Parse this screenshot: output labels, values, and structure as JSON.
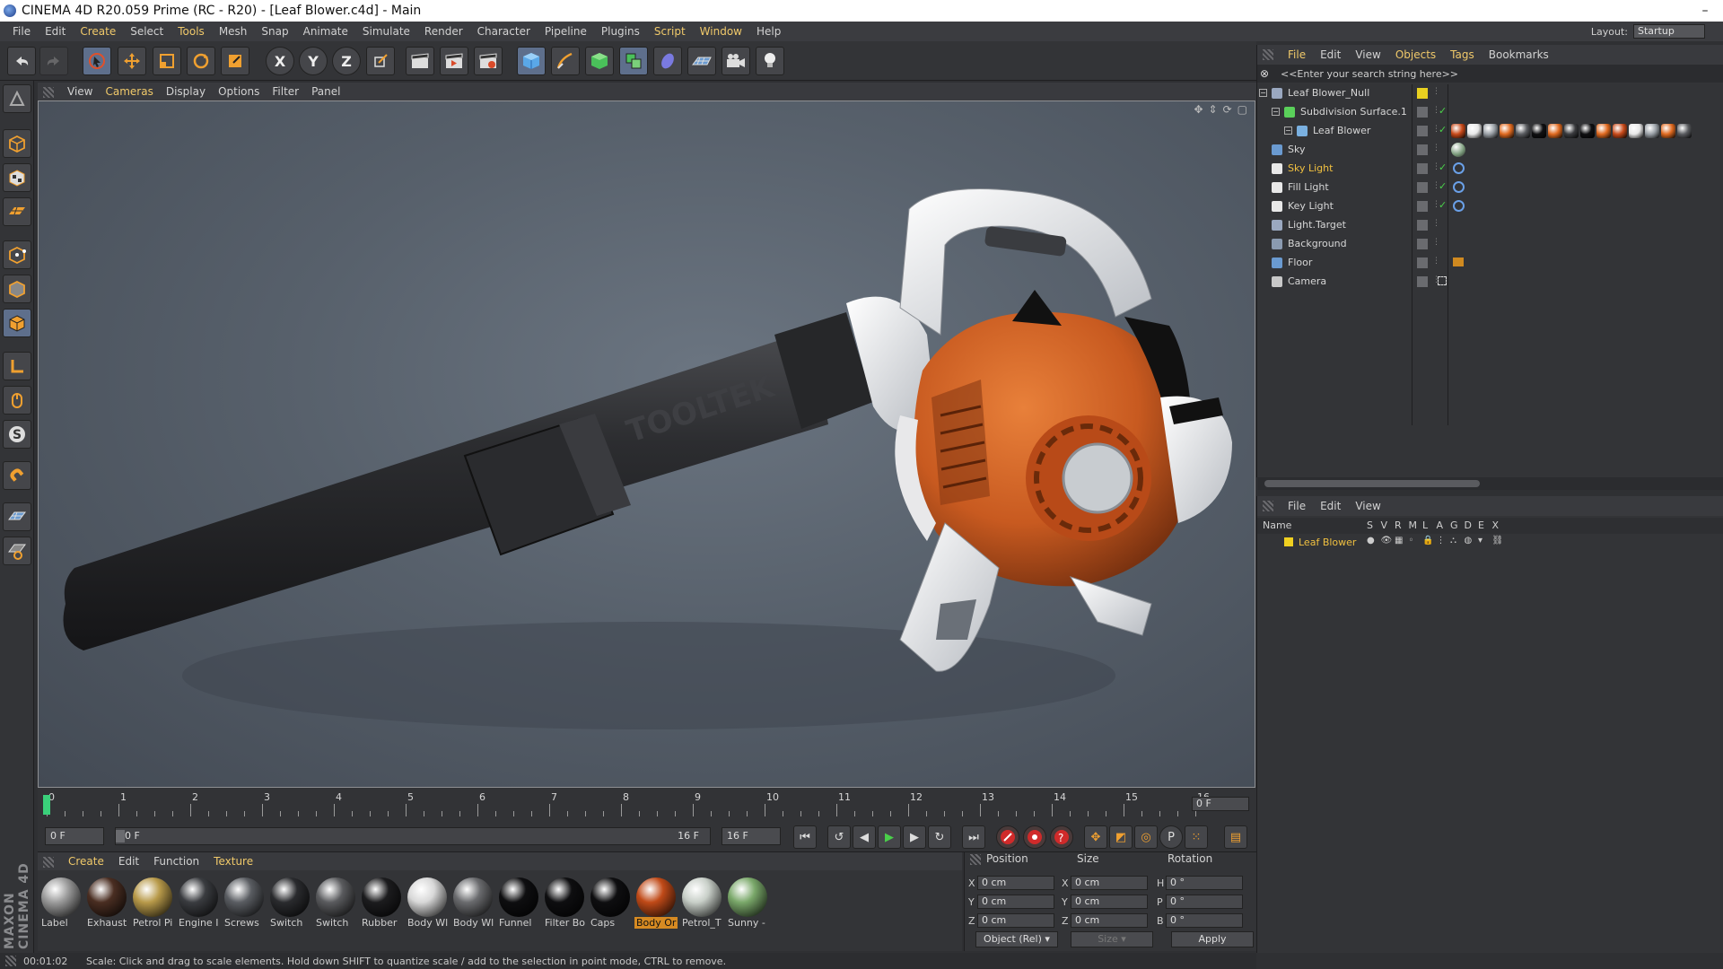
{
  "window": {
    "title": "CINEMA 4D R20.059 Prime (RC - R20) - [Leaf Blower.c4d] - Main",
    "minimize": "–"
  },
  "menubar": [
    "File",
    "Edit",
    "Create",
    "Select",
    "Tools",
    "Mesh",
    "Snap",
    "Animate",
    "Simulate",
    "Render",
    "Character",
    "Pipeline",
    "Plugins",
    "Script",
    "Window",
    "Help"
  ],
  "menubar_highlight": [
    "Create",
    "Tools",
    "Script",
    "Window"
  ],
  "layout": {
    "label": "Layout:",
    "value": "Startup"
  },
  "toolbar": {
    "x": "X",
    "y": "Y",
    "z": "Z"
  },
  "viewport_menu": [
    "View",
    "Cameras",
    "Display",
    "Options",
    "Filter",
    "Panel"
  ],
  "viewport_menu_highlight": [
    "Cameras"
  ],
  "model": {
    "brand": "TOOLTEK"
  },
  "timeline": {
    "ticks": [
      "0",
      "1",
      "2",
      "3",
      "4",
      "5",
      "6",
      "7",
      "8",
      "9",
      "10",
      "11",
      "12",
      "13",
      "14",
      "15",
      "16"
    ],
    "frame": "0 F"
  },
  "playbar": {
    "start": "0 F",
    "range_start": "0 F",
    "range_end": "16 F",
    "end": "16 F",
    "playhead_fraction": 0
  },
  "materials": {
    "menu": [
      "Create",
      "Edit",
      "Function",
      "Texture"
    ],
    "menu_highlight": [
      "Create",
      "Texture"
    ],
    "items": [
      {
        "label": "Label",
        "color": "#9c9c9c"
      },
      {
        "label": "Exhaust",
        "color": "#4a2e22"
      },
      {
        "label": "Petrol Pi",
        "color": "#b89a4a"
      },
      {
        "label": "Engine I",
        "color": "#3a3c40"
      },
      {
        "label": "Screws",
        "color": "#5a5d62"
      },
      {
        "label": "Switch",
        "color": "#2a2b2e"
      },
      {
        "label": "Switch",
        "color": "#5a5b5e"
      },
      {
        "label": "Rubber",
        "color": "#1c1c1e"
      },
      {
        "label": "Body Wl",
        "color": "#d8d8d8"
      },
      {
        "label": "Body Wl",
        "color": "#6a6b6e"
      },
      {
        "label": "Funnel",
        "color": "#0e0e10"
      },
      {
        "label": "Filter Bo",
        "color": "#0e0e10"
      },
      {
        "label": "Caps",
        "color": "#0e0e10"
      },
      {
        "label": "Body Or",
        "color": "#c04a18"
      },
      {
        "label": "Petrol_T",
        "color": "#c8cfc8"
      },
      {
        "label": "Sunny -",
        "color": "#7aa86a"
      }
    ],
    "selected_index": 13
  },
  "attributes": {
    "headers": {
      "position": "Position",
      "size": "Size",
      "rotation": "Rotation"
    },
    "rows": [
      {
        "axis": "X",
        "pos": "0 cm",
        "size_axis": "X",
        "size": "0 cm",
        "rot_axis": "H",
        "rot": "0 °"
      },
      {
        "axis": "Y",
        "pos": "0 cm",
        "size_axis": "Y",
        "size": "0 cm",
        "rot_axis": "P",
        "rot": "0 °"
      },
      {
        "axis": "Z",
        "pos": "0 cm",
        "size_axis": "Z",
        "size": "0 cm",
        "rot_axis": "B",
        "rot": "0 °"
      }
    ],
    "mode": "Object (Rel)",
    "size_mode": "Size",
    "apply": "Apply"
  },
  "status": {
    "time": "00:01:02",
    "message": "Scale: Click and drag to scale elements. Hold down SHIFT to quantize scale / add to the selection in point mode, CTRL to remove."
  },
  "object_manager": {
    "menu": [
      "File",
      "Edit",
      "View",
      "Objects",
      "Tags",
      "Bookmarks"
    ],
    "menu_highlight": [
      "File",
      "Objects",
      "Tags"
    ],
    "search_placeholder": "<<Enter your search string here>>",
    "objects": [
      {
        "name": "Leaf Blower_Null",
        "indent": 0,
        "highlight": false,
        "icon_color": "#9aa8c0"
      },
      {
        "name": "Subdivision Surface.1",
        "indent": 1,
        "highlight": false,
        "icon_color": "#5ad05a"
      },
      {
        "name": "Leaf Blower",
        "indent": 2,
        "highlight": false,
        "icon_color": "#7ab0e0"
      },
      {
        "name": "Sky",
        "indent": 0,
        "highlight": false,
        "icon_color": "#6a9ad0"
      },
      {
        "name": "Sky Light",
        "indent": 0,
        "highlight": true,
        "icon_color": "#e8e8e8"
      },
      {
        "name": "Fill Light",
        "indent": 0,
        "highlight": false,
        "icon_color": "#e8e8e8"
      },
      {
        "name": "Key Light",
        "indent": 0,
        "highlight": false,
        "icon_color": "#e8e8e8"
      },
      {
        "name": "Light.Target",
        "indent": 0,
        "highlight": false,
        "icon_color": "#9aa8c0"
      },
      {
        "name": "Background",
        "indent": 0,
        "highlight": false,
        "icon_color": "#8a9ab0"
      },
      {
        "name": "Floor",
        "indent": 0,
        "highlight": false,
        "icon_color": "#6a9ad0"
      },
      {
        "name": "Camera",
        "indent": 0,
        "highlight": false,
        "icon_color": "#c8c8c8"
      }
    ]
  },
  "layer_manager": {
    "menu": [
      "File",
      "Edit",
      "View"
    ],
    "columns": [
      "Name",
      "S",
      "V",
      "R",
      "M",
      "L",
      "A",
      "G",
      "D",
      "E",
      "X"
    ],
    "layers": [
      {
        "name": "Leaf Blower",
        "color": "#f0d020"
      }
    ]
  },
  "colors": {
    "accent": "#f0c040",
    "selection": "#5e6f8c",
    "orange": "#d86a2a"
  }
}
